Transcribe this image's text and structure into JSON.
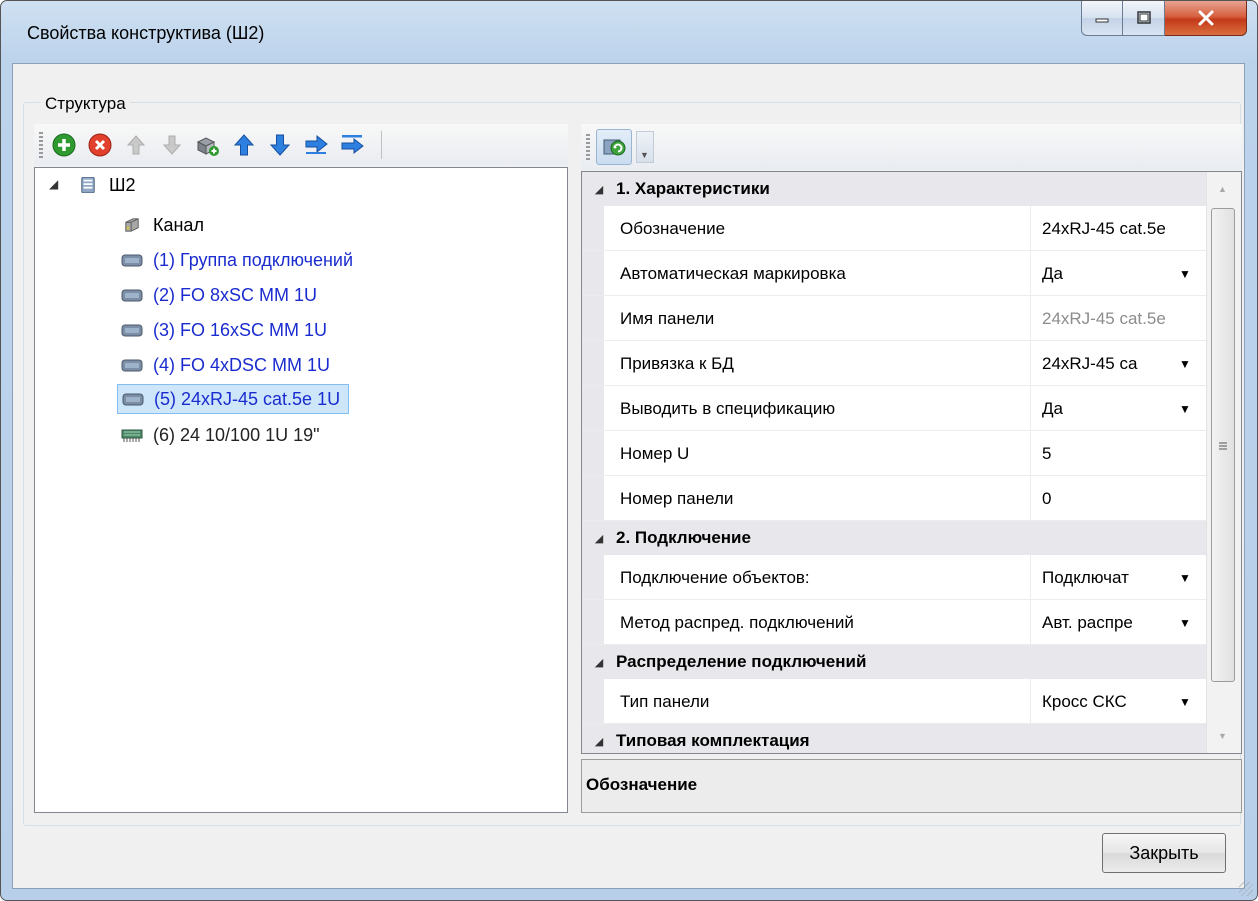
{
  "window": {
    "title": "Свойства конструктива (Ш2)"
  },
  "structure": {
    "group_label": "Структура",
    "toolbar_icons": [
      "add-icon",
      "delete-icon",
      "move-up-disabled-icon",
      "move-down-disabled-icon",
      "copy-properties-icon",
      "arrow-up-icon",
      "arrow-down-icon",
      "arrow-right-icon",
      "arrow-insert-icon"
    ],
    "root": "Ш2",
    "items": [
      {
        "label": "Канал",
        "icon": "channel-icon",
        "color": "#000000"
      },
      {
        "label": "(1) Группа подключений",
        "icon": "panel-icon",
        "color": "#1a2ccf"
      },
      {
        "label": "(2) FO 8xSC MM 1U",
        "icon": "panel-icon",
        "color": "#1a2ccf"
      },
      {
        "label": "(3) FO 16xSC MM 1U",
        "icon": "panel-icon",
        "color": "#1a2ccf"
      },
      {
        "label": "(4) FO 4xDSC MM 1U",
        "icon": "panel-icon",
        "color": "#1a2ccf"
      },
      {
        "label": "(5) 24xRJ-45 cat.5e 1U",
        "icon": "panel-icon",
        "color": "#1a2ccf",
        "selected": true
      },
      {
        "label": "(6) 24 10/100 1U 19\"",
        "icon": "switch-icon",
        "color": "#000000"
      }
    ]
  },
  "properties": {
    "toolbar_icons": [
      "refresh-icon"
    ],
    "categories": [
      {
        "name": "1. Характеристики",
        "rows": [
          {
            "name": "Обозначение",
            "value": "24xRJ-45 cat.5e",
            "dropdown": false,
            "readonly": false
          },
          {
            "name": "Автоматическая маркировка",
            "value": "Да",
            "dropdown": true,
            "readonly": false
          },
          {
            "name": "Имя панели",
            "value": "24xRJ-45 cat.5e",
            "dropdown": false,
            "readonly": true
          },
          {
            "name": "Привязка к БД",
            "value": "24xRJ-45 ca",
            "dropdown": true,
            "readonly": false
          },
          {
            "name": "Выводить в спецификацию",
            "value": "Да",
            "dropdown": true,
            "readonly": false
          },
          {
            "name": "Номер U",
            "value": "5",
            "dropdown": false,
            "readonly": false
          },
          {
            "name": "Номер панели",
            "value": "0",
            "dropdown": false,
            "readonly": false
          }
        ]
      },
      {
        "name": "2. Подключение",
        "rows": [
          {
            "name": "Подключение объектов:",
            "value": "Подключат",
            "dropdown": true,
            "readonly": false
          },
          {
            "name": "Метод распред. подключений",
            "value": "Авт. распре",
            "dropdown": true,
            "readonly": false
          }
        ]
      },
      {
        "name": "Распределение подключений",
        "rows": [
          {
            "name": "Тип панели",
            "value": "Кросс СКС",
            "dropdown": true,
            "readonly": false
          }
        ]
      },
      {
        "name": "Типовая комплектация",
        "rows": []
      }
    ],
    "help_title": "Обозначение"
  },
  "footer": {
    "close_label": "Закрыть"
  },
  "colors": {
    "title_gradient": "#bcd3ec",
    "selection": "#cde6fa",
    "link_blue": "#1a2ccf"
  }
}
